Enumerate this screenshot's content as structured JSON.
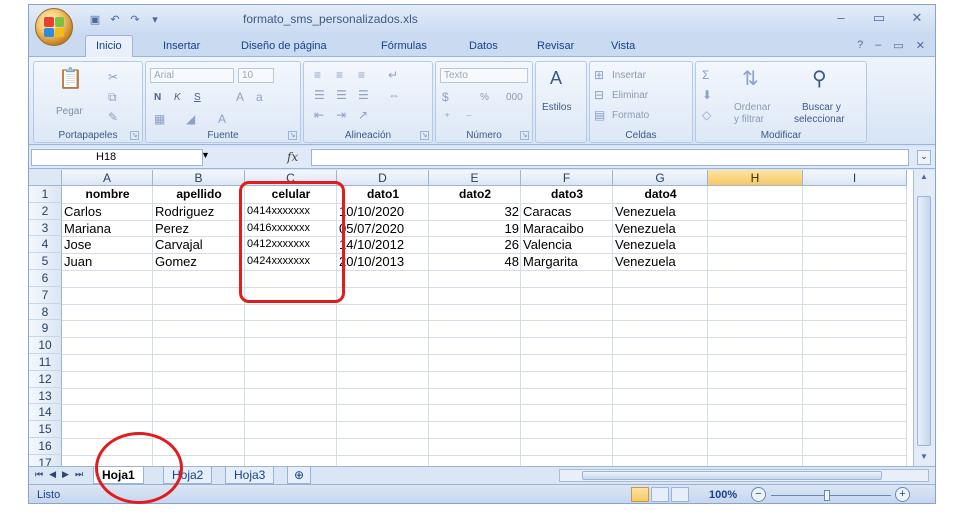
{
  "window": {
    "doc_title": "formato_sms_personalizados.xls",
    "controls": [
      "–",
      "▭",
      "✕"
    ],
    "qat_icons": [
      "save-icon",
      "undo-icon",
      "redo-icon",
      "customize-icon"
    ]
  },
  "ribbon_tabs": {
    "items": [
      "Inicio",
      "Insertar",
      "Diseño de página",
      "Fórmulas",
      "Datos",
      "Revisar",
      "Vista"
    ],
    "active": "Inicio"
  },
  "ribbon": {
    "clipboard": {
      "label": "Portapapeles",
      "paste": "Pegar"
    },
    "font": {
      "label": "Fuente",
      "name": "Arial",
      "size": "10",
      "bold": "N",
      "italic": "K",
      "underline": "S"
    },
    "alignment": {
      "label": "Alineación"
    },
    "number": {
      "label": "Número",
      "format": "Texto",
      "percent": "%",
      "thousands": "000"
    },
    "styles": {
      "label": "Estilos"
    },
    "cells": {
      "label": "Celdas",
      "insert": "Insertar",
      "delete": "Eliminar",
      "format": "Formato"
    },
    "modify": {
      "label": "Modificar",
      "sort": "Ordenar",
      "filter": "y filtrar",
      "find": "Buscar y",
      "select": "seleccionar"
    }
  },
  "formula_bar": {
    "name_box": "H18",
    "fx": "fx",
    "value": ""
  },
  "sheet": {
    "columns": [
      "A",
      "B",
      "C",
      "D",
      "E",
      "F",
      "G",
      "H",
      "I"
    ],
    "selected_column": "H",
    "row_numbers": [
      "1",
      "2",
      "3",
      "4",
      "5",
      "6",
      "7",
      "8",
      "9",
      "10",
      "11",
      "12",
      "13",
      "14",
      "15",
      "16",
      "17"
    ],
    "header_row": [
      "nombre",
      "apellido",
      "celular",
      "dato1",
      "dato2",
      "dato3",
      "dato4"
    ],
    "rows": [
      [
        "Carlos",
        "Rodriguez",
        "0414xxxxxxx",
        "10/10/2020",
        "32",
        "Caracas",
        "Venezuela"
      ],
      [
        "Mariana",
        "Perez",
        "0416xxxxxxx",
        "05/07/2020",
        "19",
        "Maracaibo",
        "Venezuela"
      ],
      [
        "Jose",
        "Carvajal",
        "0412xxxxxxx",
        "14/10/2012",
        "26",
        "Valencia",
        "Venezuela"
      ],
      [
        "Juan",
        "Gomez",
        "0424xxxxxxx",
        "20/10/2013",
        "48",
        "Margarita",
        "Venezuela"
      ]
    ]
  },
  "sheet_tabs": {
    "items": [
      "Hoja1",
      "Hoja2",
      "Hoja3"
    ],
    "active": "Hoja1"
  },
  "status": {
    "text": "Listo",
    "zoom": "100%"
  },
  "colors": {
    "annotation": "#e11c1c",
    "selected_header": "#f7c766",
    "ribbon_text": "#15428b"
  }
}
